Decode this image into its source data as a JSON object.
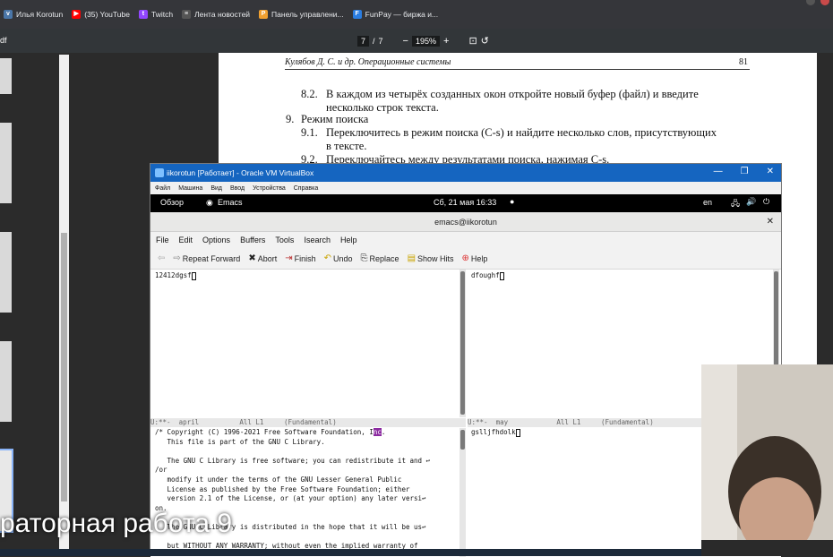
{
  "browser": {
    "bookmarks": [
      {
        "label": "Илья Korotun",
        "icon": "vk-icon",
        "color": "#4a76a8"
      },
      {
        "label": "(35) YouTube",
        "icon": "youtube-icon",
        "color": "#ff0000"
      },
      {
        "label": "Twitch",
        "icon": "twitch-icon",
        "color": "#9146ff"
      },
      {
        "label": "Лента новостей",
        "icon": "news-icon",
        "color": "#555555"
      },
      {
        "label": "Панель управлени...",
        "icon": "panel-icon",
        "color": "#f0a030"
      },
      {
        "label": "FunPay — биржа и...",
        "icon": "funpay-icon",
        "color": "#2a7de1"
      }
    ]
  },
  "pdf": {
    "file_fragment": "df",
    "page_current": "7",
    "page_sep": "/",
    "page_total": "7",
    "zoom": "195%",
    "header_left": "Кулябов Д. С. и др. Операционные системы",
    "header_right": "81",
    "lines": [
      {
        "num": "8.2.",
        "text": "В каждом из четырёх созданных окон откройте новый буфер (файл) и введите"
      },
      {
        "num": "",
        "text": "несколько строк текста."
      },
      {
        "num": "9.",
        "text": "Режим поиска"
      },
      {
        "num": "9.1.",
        "text": "Переключитесь в режим поиска (C-s) и найдите несколько слов, присутствующих"
      },
      {
        "num": "",
        "text": "в тексте."
      },
      {
        "num": "9.2.",
        "text": "Переключайтесь между результатами поиска, нажимая C-s."
      }
    ]
  },
  "vbox": {
    "title": "iikorotun [Работает] - Oracle VM VirtualBox",
    "menu": [
      "Файл",
      "Машина",
      "Вид",
      "Ввод",
      "Устройства",
      "Справка"
    ],
    "gnome": {
      "overview": "Обзор",
      "app": "Emacs",
      "clock": "Сб, 21 мая  16:33",
      "lang": "en"
    }
  },
  "emacs": {
    "title": "emacs@iikorotun",
    "menu": [
      "File",
      "Edit",
      "Options",
      "Buffers",
      "Tools",
      "Isearch",
      "Help"
    ],
    "tools": [
      {
        "label": "",
        "icon": "back-icon"
      },
      {
        "label": "Repeat Forward",
        "icon": "forward-icon"
      },
      {
        "label": "Abort",
        "icon": "abort-icon"
      },
      {
        "label": "Finish",
        "icon": "finish-icon"
      },
      {
        "label": "Undo",
        "icon": "undo-icon"
      },
      {
        "label": "Replace",
        "icon": "replace-icon"
      },
      {
        "label": "Show Hits",
        "icon": "show-hits-icon"
      },
      {
        "label": "Help",
        "icon": "help-icon"
      }
    ],
    "pane_tl": "12412dgsf",
    "pane_tr": "dfoughf",
    "modeline_left": "U:**-  april          All L1     (Fundamental)",
    "modeline_right": "U:**-  may            All L1     (Fundamental)",
    "pane_br": "gslljfhdolk",
    "bottom_lines": [
      "/* Copyright (C) 1996-2021 Free Software Foundation, Inc.",
      "   This file is part of the GNU C Library.",
      "",
      "   The GNU C Library is free software; you can redistribute it and",
      "/or",
      "   modify it under the terms of the GNU Lesser General Public",
      "   License as published by the Free Software Foundation; either",
      "   version 2.1 of the License, or (at your option) any later versi",
      "on.",
      "",
      "   The GNU C Library is distributed in the hope that it will be us",
      "",
      "   but WITHOUT ANY WARRANTY; without even the implied warranty of"
    ]
  },
  "overlay": {
    "subtitle": "раторная работа 9"
  }
}
